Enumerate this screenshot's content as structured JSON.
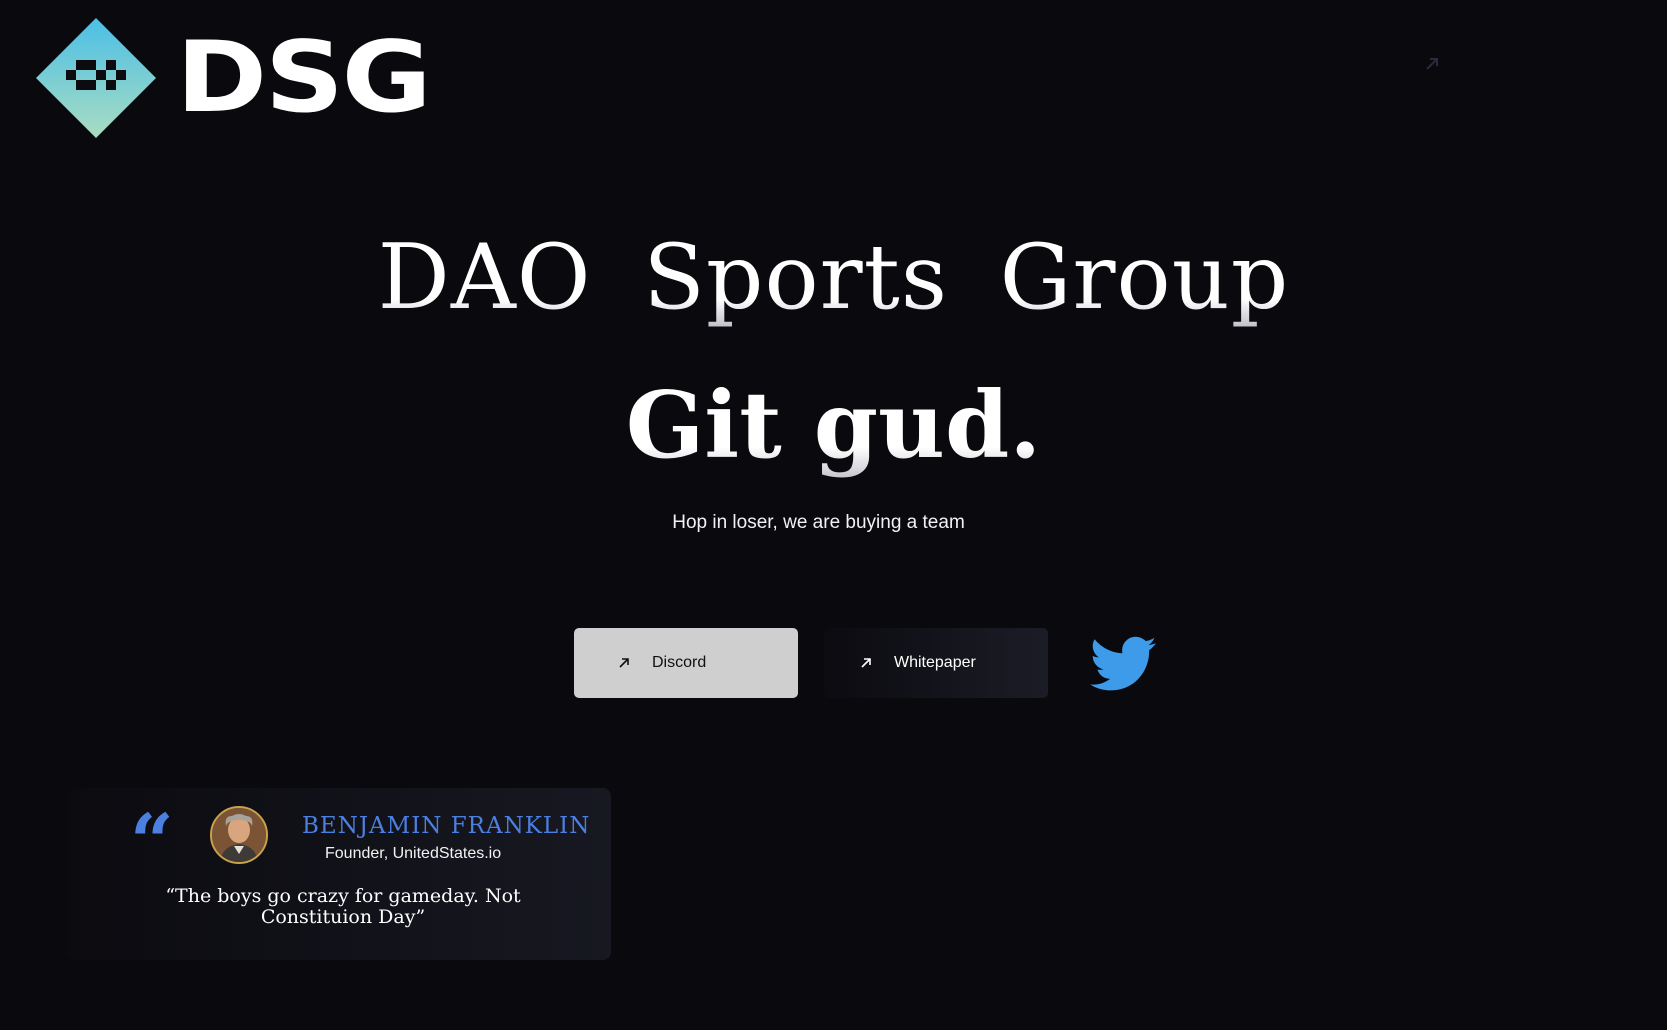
{
  "brand": {
    "name": "DSG",
    "logo_colors": [
      "#54c3e8",
      "#a8dcc4"
    ]
  },
  "hero": {
    "title": "DAO Sports Group",
    "subtitle": "Git gud.",
    "tagline": "Hop in loser, we are buying a team"
  },
  "actions": {
    "discord_label": "Discord",
    "whitepaper_label": "Whitepaper",
    "twitter_icon": "twitter-bird-icon",
    "twitter_color": "#3d9be9"
  },
  "testimonial": {
    "name": "BENJAMIN FRANKLIN",
    "role": "Founder, UnitedStates.io",
    "quote": "“The boys go crazy for gameday. Not Constituion Day”",
    "quote_mark": "“",
    "accent_color": "#4b7fe0"
  }
}
